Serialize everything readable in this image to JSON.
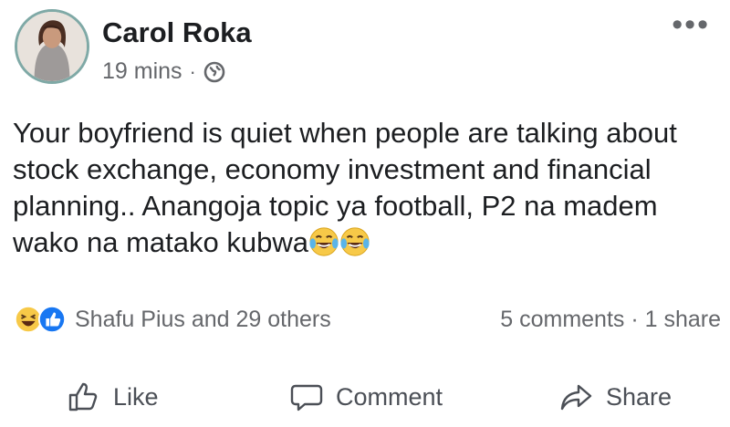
{
  "post": {
    "author": "Carol Roka",
    "time": "19 mins",
    "separator": "·",
    "privacy_icon": "globe-icon",
    "more_icon": "more-options-icon",
    "more_label": "•••",
    "text_main": "Your boyfriend is quiet when people are talking about stock exchange, economy investment and financial planning.. Anangoja topic ya football, P2 na madem wako na matako kubwa",
    "text_emojis": [
      "tears-of-joy-emoji",
      "tears-of-joy-emoji"
    ]
  },
  "reactions": {
    "icons": [
      "haha-reaction-icon",
      "like-reaction-icon"
    ],
    "names": "Shafu Pius and 29 others",
    "counts": "5 comments · 1 share"
  },
  "actions": {
    "like_label": "Like",
    "comment_label": "Comment",
    "share_label": "Share"
  },
  "colors": {
    "like_blue": "#1877f2",
    "haha_yellow": "#f7c948",
    "muted_text": "#65676b"
  }
}
